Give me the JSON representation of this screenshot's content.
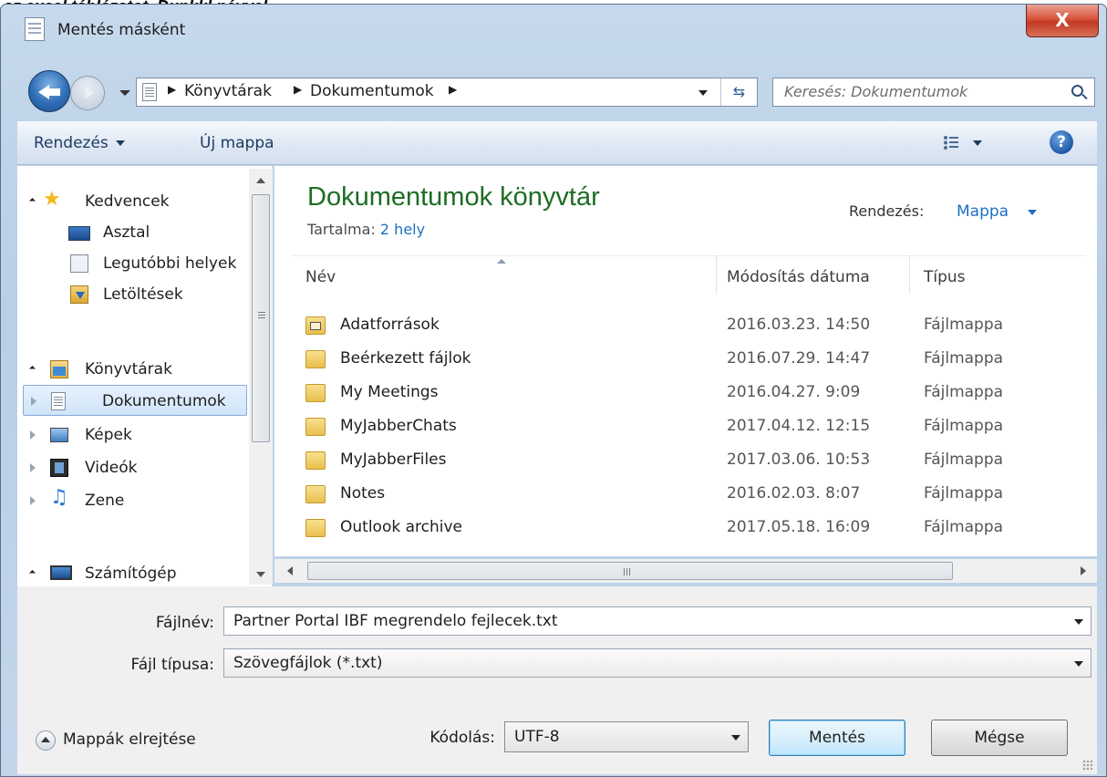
{
  "background_text": "az excel táblázatot, Dunkkl névvel",
  "window": {
    "title": "Mentés másként",
    "close_label": "X"
  },
  "address": {
    "crumbs": [
      "Könyvtárak",
      "Dokumentumok"
    ],
    "search_placeholder": "Keresés: Dokumentumok"
  },
  "toolbar": {
    "organize_label": "Rendezés",
    "new_folder_label": "Új mappa",
    "help_label": "?"
  },
  "nav": {
    "favorites": "Kedvencek",
    "desktop": "Asztal",
    "recent": "Legutóbbi helyek",
    "downloads": "Letöltések",
    "libraries": "Könyvtárak",
    "documents": "Dokumentumok",
    "pictures": "Képek",
    "videos": "Videók",
    "music": "Zene",
    "computer": "Számítógép"
  },
  "main": {
    "library_title": "Dokumentumok könyvtár",
    "includes_label": "Tartalma:",
    "includes_link": "2 hely",
    "arrange_label": "Rendezés:",
    "arrange_value": "Mappa",
    "columns": [
      "Név",
      "Módosítás dátuma",
      "Típus"
    ],
    "rows": [
      {
        "name": "Adatforrások",
        "date": "2016.03.23. 14:50",
        "type": "Fájlmappa"
      },
      {
        "name": "Beérkezett fájlok",
        "date": "2016.07.29. 14:47",
        "type": "Fájlmappa"
      },
      {
        "name": "My Meetings",
        "date": "2016.04.27. 9:09",
        "type": "Fájlmappa"
      },
      {
        "name": "MyJabberChats",
        "date": "2017.04.12. 12:15",
        "type": "Fájlmappa"
      },
      {
        "name": "MyJabberFiles",
        "date": "2017.03.06. 10:53",
        "type": "Fájlmappa"
      },
      {
        "name": "Notes",
        "date": "2016.02.03. 8:07",
        "type": "Fájlmappa"
      },
      {
        "name": "Outlook archive",
        "date": "2017.05.18. 16:09",
        "type": "Fájlmappa"
      }
    ]
  },
  "form": {
    "filename_label": "Fájlnév:",
    "filename_value": "Partner Portal IBF megrendelo fejlecek.txt",
    "filetype_label": "Fájl típusa:",
    "filetype_value": "Szövegfájlok (*.txt)",
    "encoding_label": "Kódolás:",
    "encoding_value": "UTF-8",
    "hide_folders_label": "Mappák elrejtése",
    "save_label": "Mentés",
    "cancel_label": "Mégse"
  },
  "colors": {
    "library_title": "#1e6d23",
    "link": "#1e6fc4",
    "close_button": "#c23a22"
  }
}
